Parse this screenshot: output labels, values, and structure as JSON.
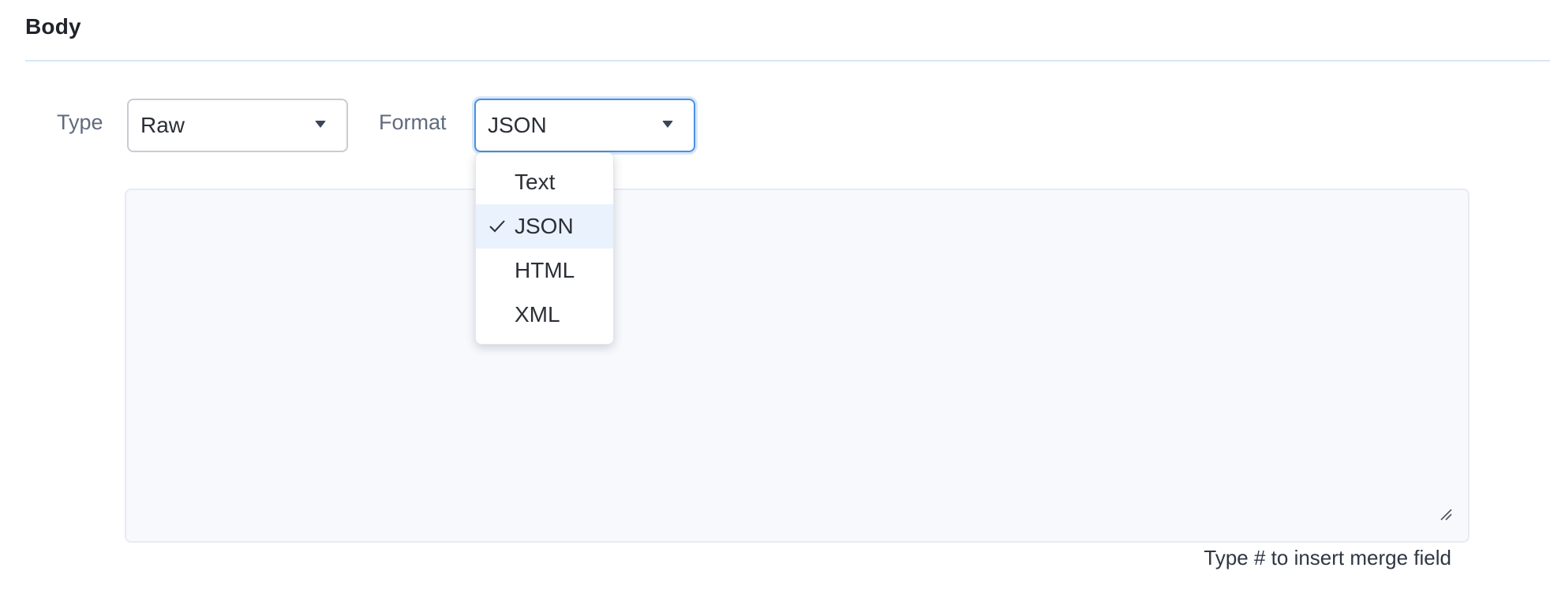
{
  "section": {
    "title": "Body"
  },
  "type_field": {
    "label": "Type",
    "value": "Raw"
  },
  "format_field": {
    "label": "Format",
    "value": "JSON",
    "dropdown_open": true,
    "options": [
      {
        "label": "Text",
        "selected": false
      },
      {
        "label": "JSON",
        "selected": true
      },
      {
        "label": "HTML",
        "selected": false
      },
      {
        "label": "XML",
        "selected": false
      }
    ]
  },
  "editor": {
    "value": ""
  },
  "hint": {
    "text": "Type # to insert merge field"
  },
  "colors": {
    "accent": "#4a90e2",
    "selected_option_bg": "#eaf2fd",
    "editor_bg": "#f7f9fd",
    "divider": "#d8e6f6"
  },
  "icons": {
    "select_caret": "caret-down-icon",
    "selected_check": "check-icon",
    "resize": "resize-handle-icon"
  }
}
